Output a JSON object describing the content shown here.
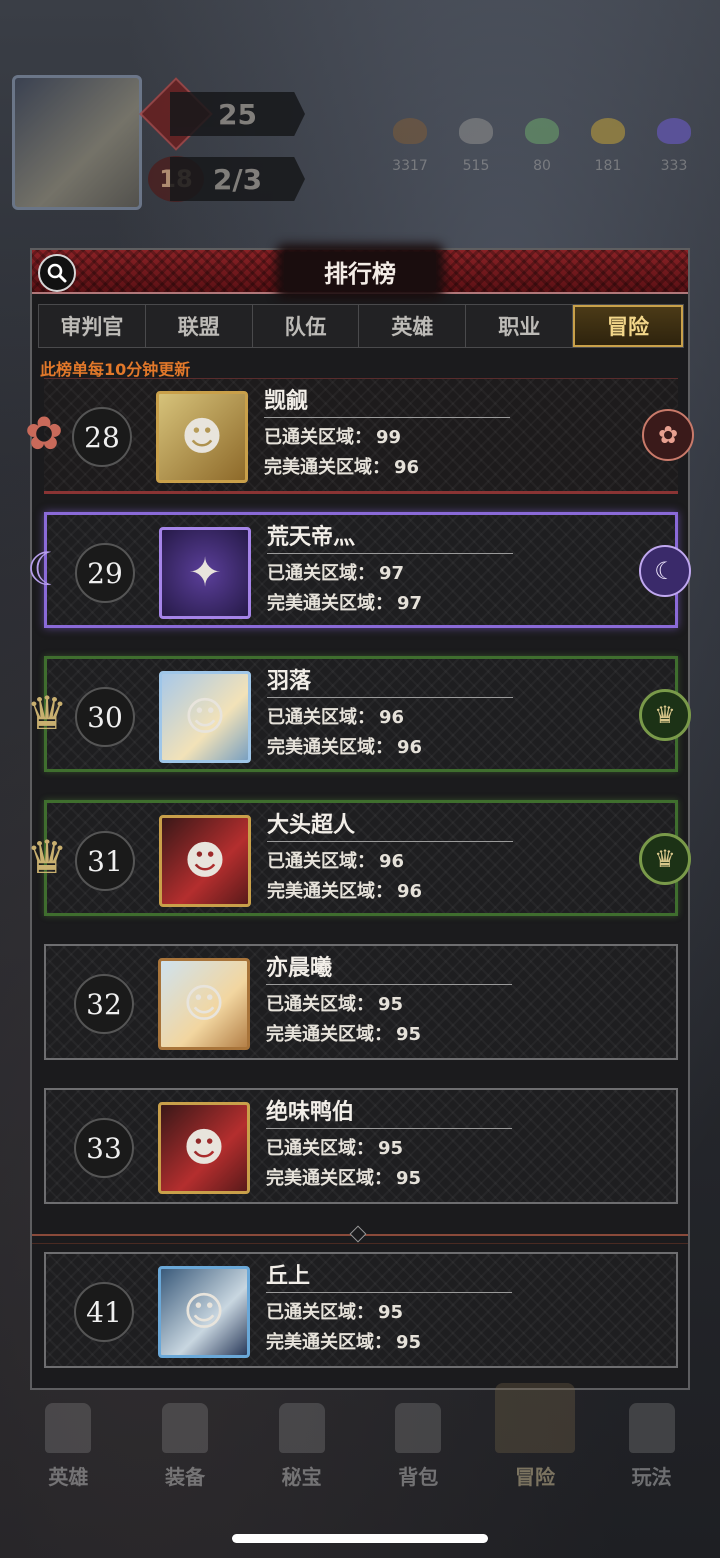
{
  "hud": {
    "level": "18",
    "energy": "25",
    "progress": "2/3",
    "resources": [
      {
        "icon": "ore-icon",
        "value": "3317",
        "color": "#7a5a3a"
      },
      {
        "icon": "stone-icon",
        "value": "515",
        "color": "#8a8a8a"
      },
      {
        "icon": "crystal-icon",
        "value": "80",
        "color": "#6aa06a"
      },
      {
        "icon": "gold-icon",
        "value": "181",
        "color": "#b89a3a"
      },
      {
        "icon": "gem-icon",
        "value": "333",
        "color": "#6a5ac8"
      }
    ]
  },
  "panel": {
    "title": "排行榜",
    "notice": "此榜单每10分钟更新"
  },
  "tabs": [
    {
      "label": "审判官",
      "active": false
    },
    {
      "label": "联盟",
      "active": false
    },
    {
      "label": "队伍",
      "active": false
    },
    {
      "label": "英雄",
      "active": false
    },
    {
      "label": "职业",
      "active": false
    },
    {
      "label": "冒险",
      "active": true
    }
  ],
  "labels": {
    "cleared": "已通关区域：",
    "perfect": "完美通关区域："
  },
  "rows": [
    {
      "rank": "28",
      "name": "觊觎",
      "cleared": "99",
      "perfect": "96",
      "style": "rose"
    },
    {
      "rank": "29",
      "name": "荒天帝灬",
      "cleared": "97",
      "perfect": "97",
      "style": "purple"
    },
    {
      "rank": "30",
      "name": "羽落",
      "cleared": "96",
      "perfect": "96",
      "style": "green"
    },
    {
      "rank": "31",
      "name": "大头超人",
      "cleared": "96",
      "perfect": "96",
      "style": "green"
    },
    {
      "rank": "32",
      "name": "亦晨曦",
      "cleared": "95",
      "perfect": "95",
      "style": "plain"
    },
    {
      "rank": "33",
      "name": "绝味鸭伯",
      "cleared": "95",
      "perfect": "95",
      "style": "plain"
    }
  ],
  "self_row": {
    "rank": "41",
    "name": "丘上",
    "cleared": "95",
    "perfect": "95"
  },
  "bottom_nav": [
    {
      "label": "英雄",
      "icon": "hero-icon"
    },
    {
      "label": "装备",
      "icon": "equipment-icon"
    },
    {
      "label": "秘宝",
      "icon": "treasure-icon"
    },
    {
      "label": "背包",
      "icon": "bag-icon"
    },
    {
      "label": "冒险",
      "icon": "crossed-swords-icon",
      "active": true
    },
    {
      "label": "玩法",
      "icon": "gate-icon"
    }
  ]
}
